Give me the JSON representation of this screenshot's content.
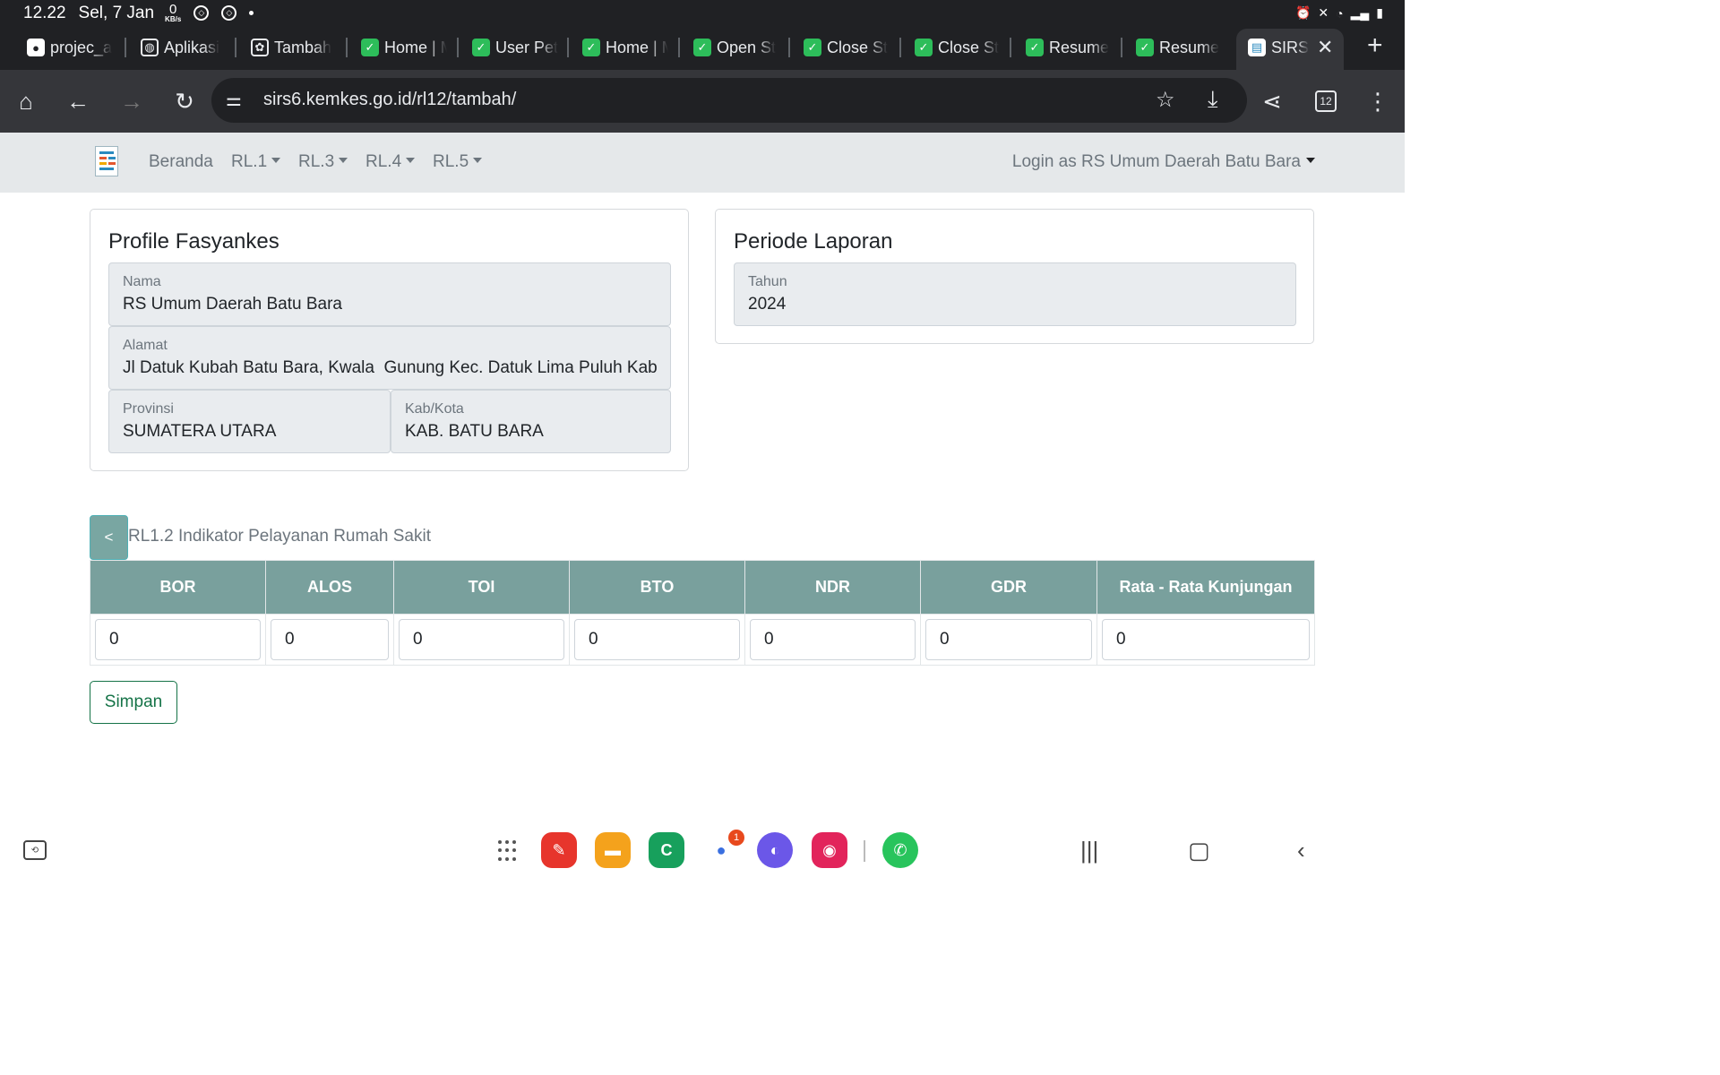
{
  "status_bar": {
    "time": "12.22",
    "date": "Sel, 7 Jan",
    "net_speed": "0",
    "net_unit": "KB/s"
  },
  "tabs": [
    {
      "title": "projec_a",
      "icon": "github-icon"
    },
    {
      "title": "Aplikasi",
      "icon": "globe-icon"
    },
    {
      "title": "Tambah",
      "icon": "chatgpt-icon"
    },
    {
      "title": "Home | M",
      "icon": "check-shield-icon"
    },
    {
      "title": "User Pet",
      "icon": "check-shield-icon"
    },
    {
      "title": "Home | M",
      "icon": "check-shield-icon"
    },
    {
      "title": "Open St",
      "icon": "check-shield-icon"
    },
    {
      "title": "Close St",
      "icon": "check-shield-icon"
    },
    {
      "title": "Close St",
      "icon": "check-shield-icon"
    },
    {
      "title": "Resume",
      "icon": "check-shield-icon"
    },
    {
      "title": "Resume",
      "icon": "check-shield-icon"
    },
    {
      "title": "SIRS",
      "icon": "sirs-icon",
      "active": true
    }
  ],
  "toolbar": {
    "url": "sirs6.kemkes.go.id/rl12/tambah/",
    "tab_count": "12"
  },
  "navbar": {
    "items": [
      "Beranda",
      "RL.1",
      "RL.3",
      "RL.4",
      "RL.5"
    ],
    "login_label": "Login as RS Umum Daerah Batu Bara"
  },
  "profile": {
    "title": "Profile Fasyankes",
    "nama_label": "Nama",
    "nama_value": "RS Umum Daerah Batu Bara",
    "alamat_label": "Alamat",
    "alamat_value": "Jl Datuk Kubah Batu Bara, Kwala  Gunung Kec. Datuk Lima Puluh Kab",
    "provinsi_label": "Provinsi",
    "provinsi_value": "SUMATERA UTARA",
    "kabkota_label": "Kab/Kota",
    "kabkota_value": "KAB. BATU BARA"
  },
  "periode": {
    "title": "Periode Laporan",
    "tahun_label": "Tahun",
    "tahun_value": "2024"
  },
  "rl_section": {
    "back_label": "<",
    "title": "RL1.2 Indikator Pelayanan Rumah Sakit",
    "columns": [
      "BOR",
      "ALOS",
      "TOI",
      "BTO",
      "NDR",
      "GDR",
      "Rata - Rata Kunjungan"
    ],
    "values": [
      "0",
      "0",
      "0",
      "0",
      "0",
      "0",
      "0"
    ],
    "save_label": "Simpan"
  },
  "dock": {
    "messages_badge": "1"
  },
  "colors": {
    "table_header": "#79a09d",
    "save_border": "#157347",
    "navbar_bg": "#e5e8ea",
    "browser_dark": "#202124"
  }
}
